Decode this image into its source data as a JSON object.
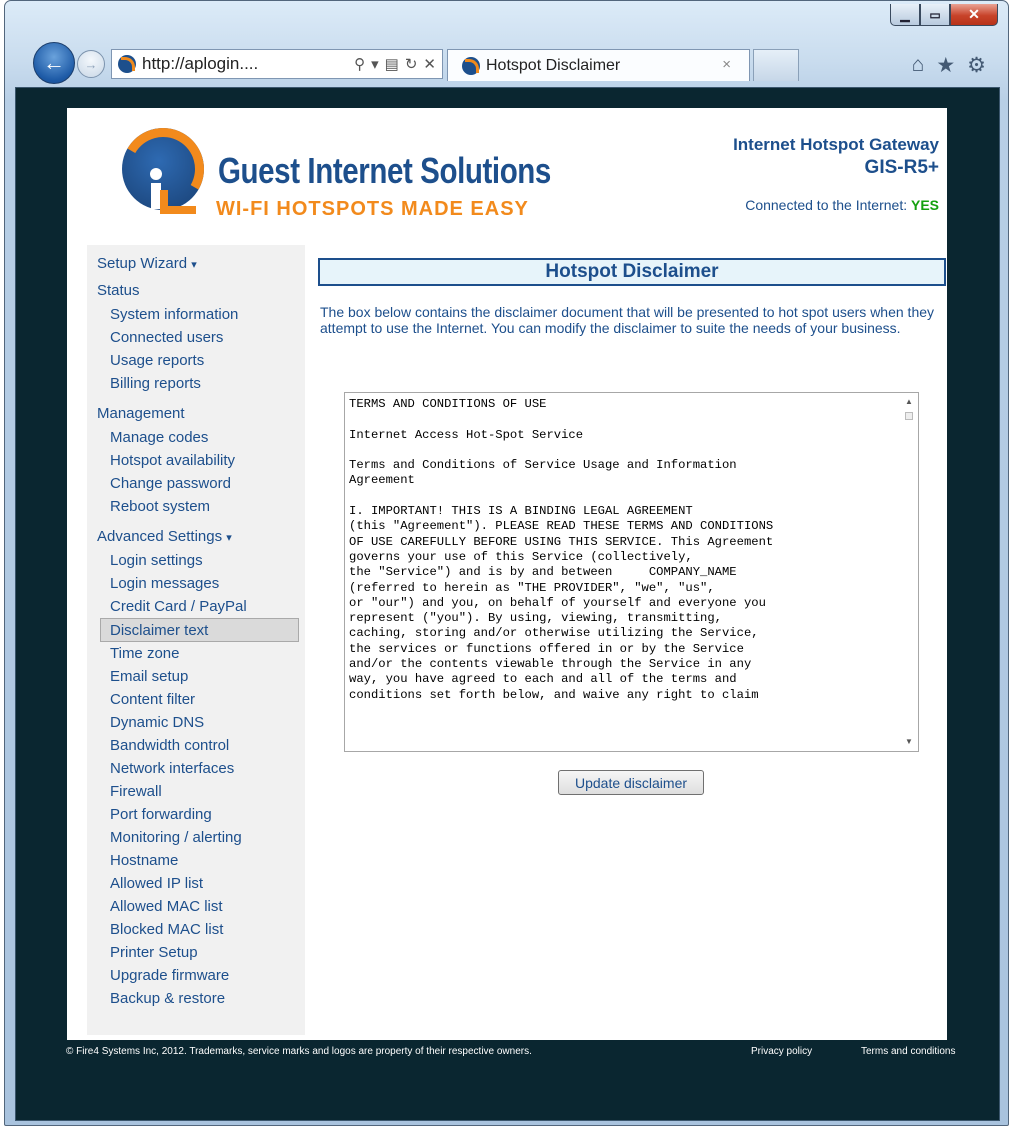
{
  "browser": {
    "address_url": "http://aplogin....",
    "tab_title": "Hotspot Disclaimer",
    "tab_close": "×"
  },
  "brand": {
    "name": "Guest Internet Solutions",
    "tagline": "WI-FI HOTSPOTS MADE EASY",
    "product_title": "Internet Hotspot Gateway",
    "model": "GIS-R5+",
    "connection_label": "Connected to the Internet:",
    "connection_status": "YES",
    "connection_color": "#14a00f",
    "primary_color": "#1d4f8c",
    "accent_color": "#f28a1c"
  },
  "sidebar": {
    "setup_wizard": "Setup Wizard",
    "status_heading": "Status",
    "status_items": [
      "System information",
      "Connected users",
      "Usage reports",
      "Billing reports"
    ],
    "management_heading": "Management",
    "management_items": [
      "Manage codes",
      "Hotspot availability",
      "Change password",
      "Reboot system"
    ],
    "advanced_heading": "Advanced Settings",
    "advanced_items": [
      "Login settings",
      "Login messages",
      "Credit Card / PayPal",
      "Disclaimer text",
      "Time zone",
      "Email setup",
      "Content filter",
      "Dynamic DNS",
      "Bandwidth control",
      "Network interfaces",
      "Firewall",
      "Port forwarding",
      "Monitoring / alerting",
      "Hostname",
      "Allowed IP list",
      "Allowed MAC list",
      "Blocked MAC list",
      "Printer Setup",
      "Upgrade firmware",
      "Backup & restore"
    ],
    "active_item": "Disclaimer text"
  },
  "main": {
    "title": "Hotspot Disclaimer",
    "intro": "The box below contains the disclaimer document that will be presented to hot spot users when they attempt to use the Internet. You can modify the disclaimer to suite the needs of your business.",
    "disclaimer_text": "TERMS AND CONDITIONS OF USE\n\nInternet Access Hot-Spot Service\n\nTerms and Conditions of Service Usage and Information\nAgreement\n\nI. IMPORTANT! THIS IS A BINDING LEGAL AGREEMENT\n(this \"Agreement\"). PLEASE READ THESE TERMS AND CONDITIONS\nOF USE CAREFULLY BEFORE USING THIS SERVICE. This Agreement\ngoverns your use of this Service (collectively,\nthe \"Service\") and is by and between     COMPANY_NAME\n(referred to herein as \"THE PROVIDER\", \"we\", \"us\",\nor \"our\") and you, on behalf of yourself and everyone you\nrepresent (\"you\"). By using, viewing, transmitting,\ncaching, storing and/or otherwise utilizing the Service,\nthe services or functions offered in or by the Service\nand/or the contents viewable through the Service in any\nway, you have agreed to each and all of the terms and\nconditions set forth below, and waive any right to claim",
    "update_button": "Update disclaimer"
  },
  "footer": {
    "copyright": "© Fire4 Systems Inc, 2012. Trademarks, service marks and logos are property of their respective owners.",
    "privacy": "Privacy policy",
    "terms": "Terms and conditions"
  }
}
